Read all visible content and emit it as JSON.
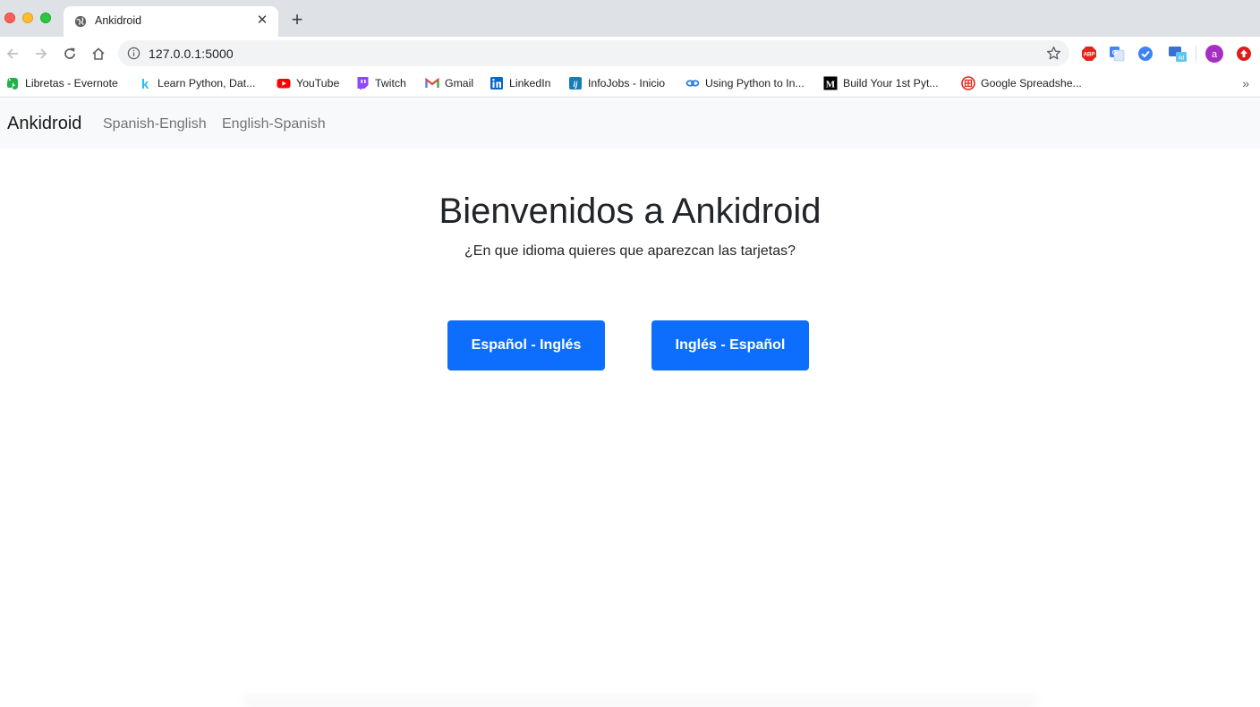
{
  "browser": {
    "tab_title": "Ankidroid",
    "tab_close": "✕",
    "new_tab": "+",
    "url": "127.0.0.1:5000",
    "profile_initial": "a",
    "abp_label": "ABP",
    "bookmarks": [
      {
        "label": "Libretas - Evernote",
        "icon": "evernote-icon"
      },
      {
        "label": "Learn Python, Dat...",
        "icon": "kaggle-icon"
      },
      {
        "label": "YouTube",
        "icon": "youtube-icon"
      },
      {
        "label": "Twitch",
        "icon": "twitch-icon"
      },
      {
        "label": "Gmail",
        "icon": "gmail-icon"
      },
      {
        "label": "LinkedIn",
        "icon": "linkedin-icon"
      },
      {
        "label": "InfoJobs - Inicio",
        "icon": "infojobs-icon"
      },
      {
        "label": "Using Python to In...",
        "icon": "link-icon"
      },
      {
        "label": "Build Your 1st Pyt...",
        "icon": "medium-icon"
      },
      {
        "label": "Google Spreadshe...",
        "icon": "spreadsheet-icon"
      }
    ],
    "bookmarks_more": "»"
  },
  "navbar": {
    "brand": "Ankidroid",
    "links": [
      "Spanish-English",
      "English-Spanish"
    ]
  },
  "main": {
    "title": "Bienvenidos a Ankidroid",
    "subtitle": "¿En que idioma quieres que aparezcan las tarjetas?",
    "buttons": [
      "Español - Inglés",
      "Inglés - Español"
    ]
  },
  "colors": {
    "primary": "#0d6efd",
    "navbar_bg": "#f8f9fa",
    "tabstrip_bg": "#dee1e6"
  }
}
